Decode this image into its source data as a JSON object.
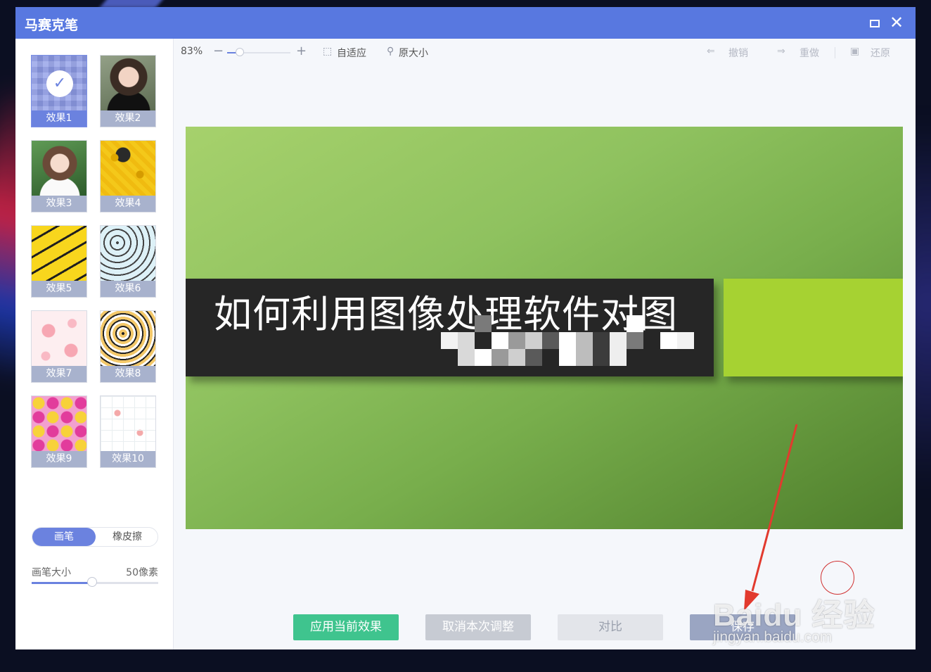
{
  "window": {
    "title": "马赛克笔"
  },
  "effects": [
    {
      "label": "效果1",
      "selected": true
    },
    {
      "label": "效果2",
      "selected": false
    },
    {
      "label": "效果3",
      "selected": false
    },
    {
      "label": "效果4",
      "selected": false
    },
    {
      "label": "效果5",
      "selected": false
    },
    {
      "label": "效果6",
      "selected": false
    },
    {
      "label": "效果7",
      "selected": false
    },
    {
      "label": "效果8",
      "selected": false
    },
    {
      "label": "效果9",
      "selected": false
    },
    {
      "label": "效果10",
      "selected": false
    }
  ],
  "brush": {
    "modes": [
      "画笔",
      "橡皮擦"
    ],
    "active_mode": "画笔",
    "size_label": "画笔大小",
    "size_value": "50像素",
    "size_fraction": 0.48
  },
  "toolbar": {
    "zoom_percent": "83%",
    "zoom_fraction": 0.2,
    "fit_label": "自适应",
    "original_label": "原大小",
    "undo_label": "撤销",
    "redo_label": "重做",
    "restore_label": "还原"
  },
  "canvas": {
    "headline": "如何利用图像处理软件对图"
  },
  "actions": {
    "apply": "应用当前效果",
    "cancel": "取消本次调整",
    "compare": "对比",
    "save": "保存"
  },
  "watermark": {
    "logo": "Baidu 经验",
    "url": "jingyan.baidu.com"
  },
  "colors": {
    "titlebar": "#5878e0",
    "accent": "#6b82df",
    "apply_button": "#3fc48e",
    "canvas_green": "#8fc25f",
    "canvas_accent": "#a6d232"
  }
}
